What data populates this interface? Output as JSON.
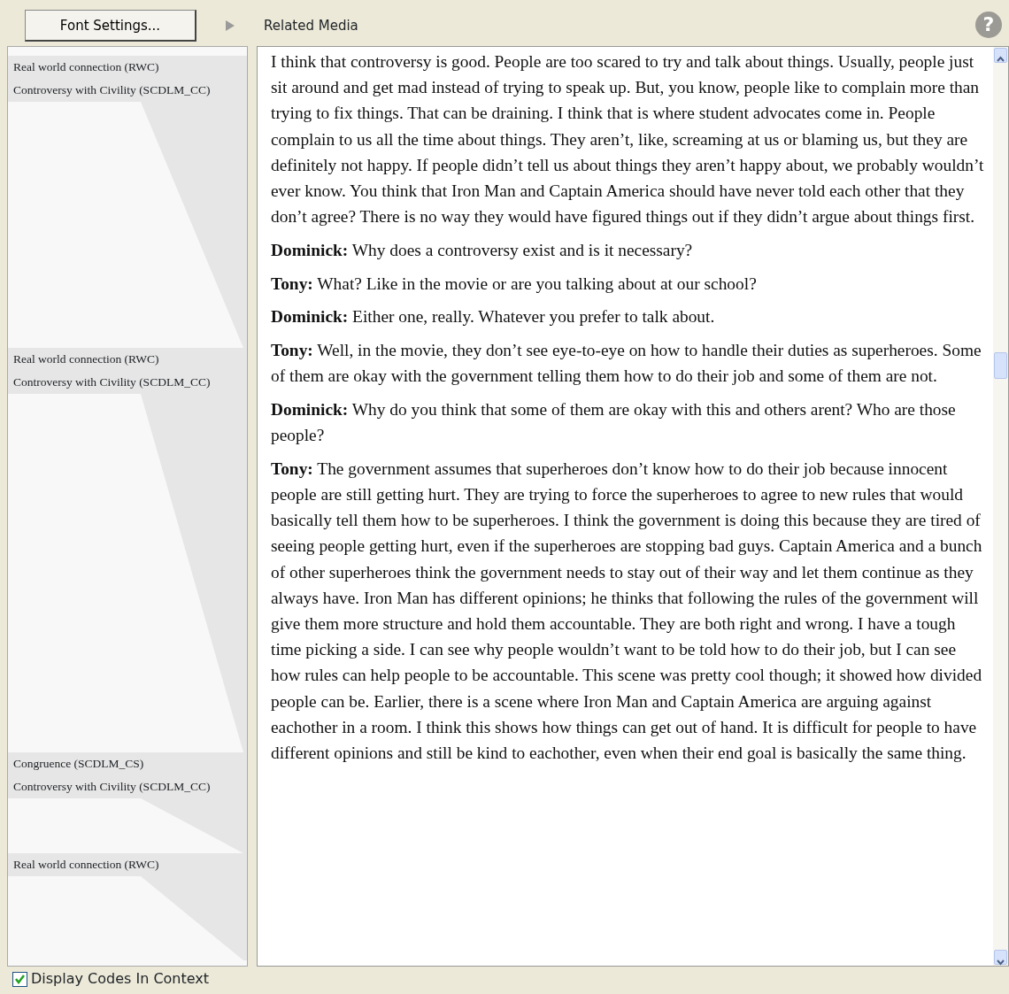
{
  "toolbar": {
    "font_button": "Font Settings...",
    "related_media": "Related Media",
    "related_media_expanded": false,
    "help": "?"
  },
  "codes": [
    {
      "labels": [
        "Real world connection (RWC)",
        "Controversy with Civility (SCDLM_CC)"
      ]
    },
    {
      "labels": [
        "Real world connection (RWC)",
        "Controversy with Civility (SCDLM_CC)"
      ]
    },
    {
      "labels": [
        "Congruence (SCDLM_CS)",
        "Controversy with Civility (SCDLM_CC)"
      ]
    },
    {
      "labels": [
        "Real world connection (RWC)"
      ]
    }
  ],
  "paragraphs": [
    "I think that controversy is good. People are too scared to try and talk about things. Usually, people just sit around and get mad instead of trying to speak up. But, you know, people like to complain more than trying to fix things. That can be draining. I think that is where student advocates come in. People complain to us all the time about things. They aren’t, like, screaming at us or blaming us, but they are definitely not happy. If people didn’t tell us about things they aren’t happy about, we probably wouldn’t ever know. You think that Iron Man and Captain America should have never told each other that they don’t agree? There is no way they would have figured things out if they didn’t argue about things first.",
    "**Dominick:** Why does a controversy exist and is it necessary?",
    "**Tony:** What? Like in the movie or are you talking about at our school?",
    "**Dominick:** Either one, really. Whatever you prefer to talk about.",
    "**Tony:** Well, in the movie, they don’t see eye-to-eye on how to handle their duties as superheroes. Some of them are okay with the government telling them how to do their job and some of them are not.",
    "**Dominick:** Why do you think that some of them are okay with this and others arent? Who are those people?",
    "**Tony:** The government assumes that superheroes don’t know how to do their job because innocent people are still getting hurt. They are trying to force the superheroes to agree to new rules that would basically tell them how to be superheroes. I think the government is doing this because they are tired of seeing people getting hurt, even if the superheroes are stopping bad guys. Captain America and a bunch of other superheroes think the government needs to stay out of their way and let them continue as they always have. Iron Man has different opinions; he thinks that following the rules of the government will give them more structure and hold them accountable. They are both right and wrong. I have a tough time picking a side. I can see why people wouldn’t want to be told how to do their job, but I can see how rules can help people to be accountable. This scene was pretty cool though; it showed how divided people can be. Earlier, there is a scene where Iron Man and Captain America are arguing against eachother in a room. I think this shows how things can get out of hand. It is difficult for people to have different opinions and still be kind to eachother, even when their end goal is basically the same thing."
  ],
  "display_codes": {
    "label": "Display Codes In Context",
    "checked": true
  }
}
